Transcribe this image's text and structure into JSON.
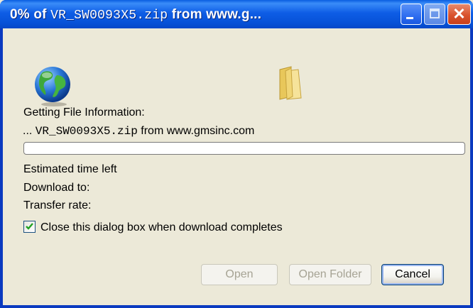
{
  "window": {
    "title_percent_prefix": "0% of",
    "title_filename": "VR_SW0093X5.zip",
    "title_suffix": "from www.g..."
  },
  "status": {
    "heading": "Getting File Information:",
    "file_prefix": "...",
    "file_name": "VR_SW0093X5.zip",
    "file_source": "from www.gmsinc.com"
  },
  "progress": {
    "percent": 0
  },
  "info": {
    "estimated_time_label": "Estimated time left",
    "download_to_label": "Download to:",
    "transfer_rate_label": "Transfer rate:"
  },
  "options": {
    "close_on_complete_label": "Close this dialog box when download completes",
    "close_on_complete_checked": true
  },
  "buttons": {
    "open": "Open",
    "open_folder": "Open Folder",
    "cancel": "Cancel"
  },
  "icons": {
    "globe": "globe-icon",
    "folder": "folder-icon"
  }
}
